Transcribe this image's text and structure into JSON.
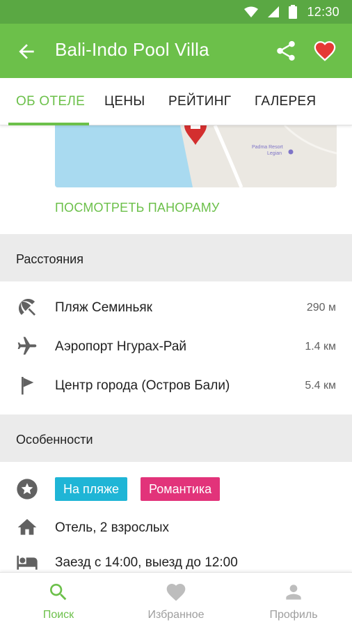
{
  "status_bar": {
    "time": "12:30"
  },
  "app_bar": {
    "title": "Bali-Indo Pool Villa"
  },
  "tabs": [
    {
      "label": "ОБ ОТЕЛЕ",
      "active": true
    },
    {
      "label": "ЦЕНЫ",
      "active": false
    },
    {
      "label": "РЕЙТИНГ",
      "active": false
    },
    {
      "label": "ГАЛЕРЕЯ",
      "active": false
    }
  ],
  "map": {
    "poi_name": "Padma Resort",
    "poi_sub": "Legian"
  },
  "panorama_label": "ПОСМОТРЕТЬ ПАНОРАМУ",
  "distances": {
    "header": "Расстояния",
    "items": [
      {
        "icon": "beach-umbrella-icon",
        "label": "Пляж Семиньяк",
        "value": "290 м"
      },
      {
        "icon": "airplane-icon",
        "label": "Аэропорт Нгурах-Рай",
        "value": "1.4 км"
      },
      {
        "icon": "flag-icon",
        "label": "Центр города (Остров Бали)",
        "value": "5.4 км"
      }
    ]
  },
  "features": {
    "header": "Особенности",
    "tags": [
      {
        "label": "На пляже",
        "color": "#1fb5d6"
      },
      {
        "label": "Романтика",
        "color": "#e2337a"
      }
    ],
    "type_text": "Отель, 2 взрослых",
    "checkin_text": "Заезд с 14:00, выезд до 12:00"
  },
  "bottom_nav": [
    {
      "label": "Поиск",
      "icon": "search-icon",
      "active": true
    },
    {
      "label": "Избранное",
      "icon": "heart-icon",
      "active": false
    },
    {
      "label": "Профиль",
      "icon": "person-icon",
      "active": false
    }
  ],
  "colors": {
    "primary": "#6cc04a",
    "status_bar": "#5aa843",
    "favorite": "#e53935",
    "tag_beach": "#1fb5d6",
    "tag_romance": "#e2337a"
  }
}
